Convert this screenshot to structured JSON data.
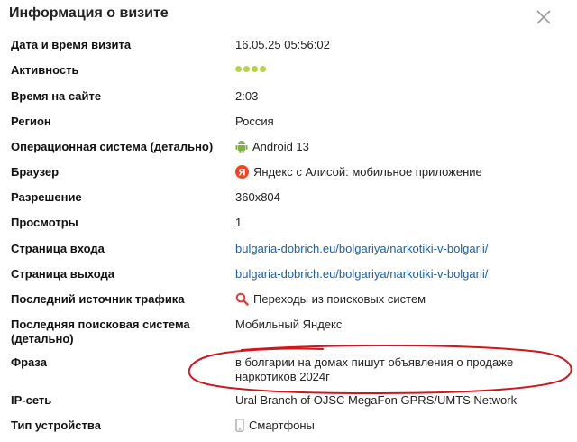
{
  "dialog": {
    "title": "Информация о визите"
  },
  "rows": [
    {
      "label": "Дата и время визита",
      "value": "16.05.25 05:56:02"
    },
    {
      "label": "Активность",
      "value": "",
      "activity_dots": 4,
      "dot_color": "#b7d541"
    },
    {
      "label": "Время на сайте",
      "value": "2:03"
    },
    {
      "label": "Регион",
      "value": "Россия"
    },
    {
      "label": "Операционная система (детально)",
      "value": "Android 13",
      "icon": "android-icon"
    },
    {
      "label": "Браузер",
      "value": "Яндекс с Алисой: мобильное приложение",
      "icon": "yandex-icon"
    },
    {
      "label": "Разрешение",
      "value": "360x804"
    },
    {
      "label": "Просмотры",
      "value": "1"
    },
    {
      "label": "Страница входа",
      "value": "bulgaria-dobrich.eu/bolgariya/narkotiki-v-bolgarii/"
    },
    {
      "label": "Страница выхода",
      "value": "bulgaria-dobrich.eu/bolgariya/narkotiki-v-bolgarii/"
    },
    {
      "label": "Последний источник трафика",
      "value": "Переходы из поисковых систем",
      "icon": "search-icon"
    },
    {
      "label": "Последняя поисковая система (детально)",
      "value": "Мобильный Яндекс"
    },
    {
      "label": "Фраза",
      "value": "в болгарии на домах пишут объявления о продаже наркотиков 2024г"
    },
    {
      "label": "IP-сеть",
      "value": "Ural Branch of OJSC MegaFon GPRS/UMTS Network"
    },
    {
      "label": "Тип устройства",
      "value": "Смартфоны",
      "icon": "smartphone-icon"
    }
  ],
  "colors": {
    "link": "#1a5fb4",
    "annotation_circle": "#d0161b",
    "android": "#7cb342",
    "yandex": "#fc3f1d"
  }
}
